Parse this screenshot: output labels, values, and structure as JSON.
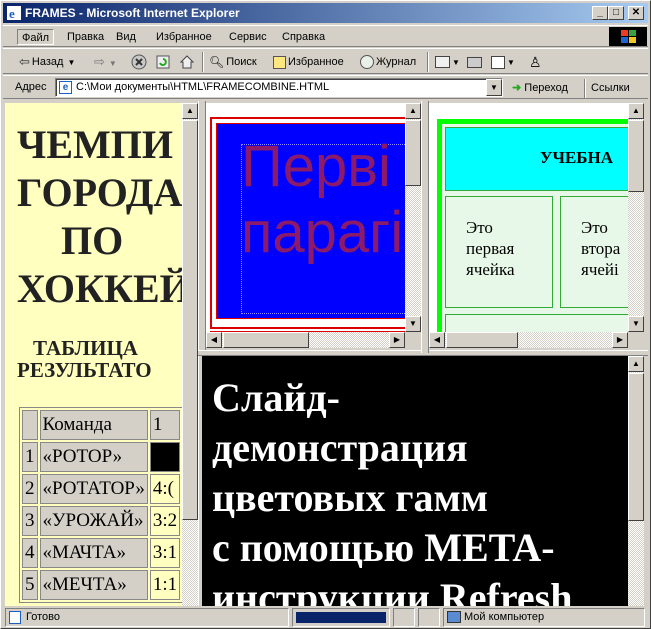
{
  "window": {
    "title": "FRAMES - Microsoft Internet Explorer",
    "min": "_",
    "max": "□",
    "close": "✕"
  },
  "menu": {
    "file": "Файл",
    "edit": "Правка",
    "view": "Вид",
    "favorites": "Избранное",
    "service": "Сервис",
    "help": "Справка"
  },
  "toolbar": {
    "back": "Назад",
    "search": "Поиск",
    "favorites": "Избранное",
    "history": "Журнал"
  },
  "address": {
    "label": "Адрес",
    "value": "C:\\Мои документы\\HTML\\FRAMECOMBINE.HTML",
    "go": "Переход",
    "links": "Ссылки"
  },
  "left_frame": {
    "heading_lines": [
      "ЧЕМПИ",
      "ГОРОДА",
      "ПО",
      "ХОККЕЙ"
    ],
    "subheading_lines": [
      "ТАБЛИЦА",
      "РЕЗУЛЬТАТО"
    ],
    "table": {
      "header": [
        "",
        "Команда",
        "1"
      ],
      "rows": [
        [
          "1",
          "«РОТОР»",
          ""
        ],
        [
          "2",
          "«РОТАТОР»",
          "4:("
        ],
        [
          "3",
          "«УРОЖАЙ»",
          "3:2"
        ],
        [
          "4",
          "«МАЧТА»",
          "3:1"
        ],
        [
          "5",
          "«МЕЧТА»",
          "1:1"
        ]
      ]
    }
  },
  "top_mid_frame": {
    "line1": "Перві",
    "line2": "парагі"
  },
  "top_right_frame": {
    "heading": "УЧЕБНА",
    "cell1": [
      "Это",
      "первая",
      "ячейка"
    ],
    "cell2": [
      "Это",
      "втора",
      "ячейі"
    ]
  },
  "bottom_frame": {
    "lines": [
      "Слайд-",
      "демонстрация",
      "цветовых гамм",
      "с помощью META-",
      "инструкции Refresh"
    ]
  },
  "status": {
    "text": "Готово",
    "zone": "Мой компьютер"
  }
}
